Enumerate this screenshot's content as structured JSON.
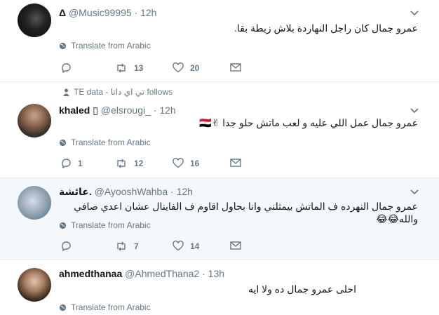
{
  "translate_label": "Translate from Arabic",
  "colors": {
    "muted": "#657786",
    "border": "#e6ecf0",
    "highlight_bg": "#f5f8fa"
  },
  "tweets": [
    {
      "name": "Δ",
      "handle": "@Music99995",
      "time": "12h",
      "text": "عمرو جمال كان راجل النهاردة بلاش زيطة بقا.",
      "replies": "",
      "retweets": "13",
      "likes": "20"
    },
    {
      "context": "TE data - تي اي داتا follows",
      "name": "khaled",
      "name_badge": "▯",
      "handle": "@elsrougi_",
      "time": "12h",
      "text": "عمرو جمال عمل اللي عليه و لعب ماتش حلو جدا ✌🇪🇬",
      "replies": "1",
      "retweets": "12",
      "likes": "16"
    },
    {
      "name": "عائشة.",
      "handle": "@AyooshWahba",
      "time": "12h",
      "text": "عمرو جمال النهرده ف الماتش بيمثلني وانا بحاول اقاوم ف الفاينال عشان اعدي صافي والله😂😂",
      "replies": "",
      "retweets": "7",
      "likes": "14"
    },
    {
      "name": "ahmedthanaa",
      "handle": "@AhmedThana2",
      "time": "13h",
      "text": "احلى عمرو جمال ده ولا ايه"
    }
  ],
  "icons": [
    "reply-icon",
    "retweet-icon",
    "heart-icon",
    "message-icon",
    "globe-icon",
    "caret-down-icon",
    "person-icon"
  ]
}
